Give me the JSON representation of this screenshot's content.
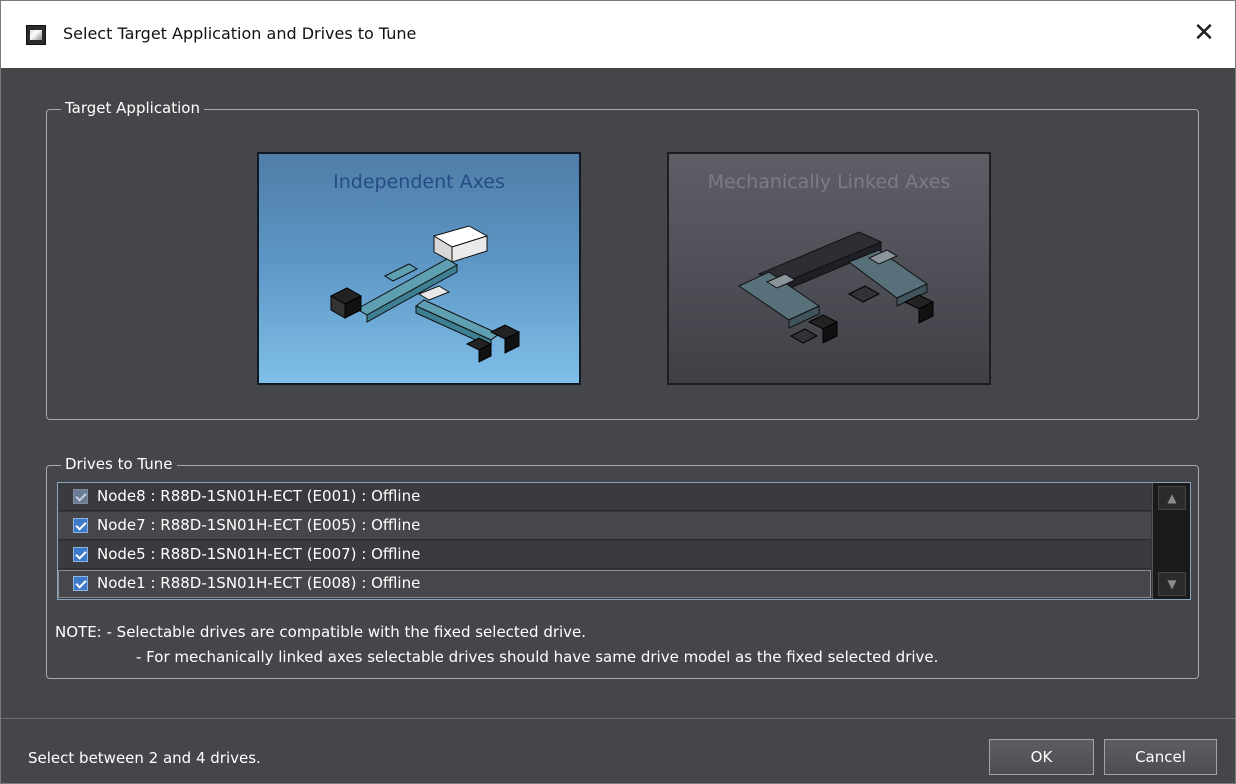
{
  "window": {
    "title": "Select Target Application and Drives to Tune",
    "close_glyph": "✕"
  },
  "target_application": {
    "legend": "Target Application",
    "options": [
      {
        "label": "Independent Axes",
        "selected": true
      },
      {
        "label": "Mechanically Linked Axes",
        "selected": false
      }
    ]
  },
  "drives": {
    "legend": "Drives to Tune",
    "items": [
      {
        "label": "Node8 : R88D-1SN01H-ECT (E001) : Offline",
        "checked": true,
        "enabled": false
      },
      {
        "label": "Node7 : R88D-1SN01H-ECT (E005) : Offline",
        "checked": true,
        "enabled": true
      },
      {
        "label": "Node5 : R88D-1SN01H-ECT (E007) : Offline",
        "checked": true,
        "enabled": true
      },
      {
        "label": "Node1 : R88D-1SN01H-ECT (E008) : Offline",
        "checked": true,
        "enabled": true
      }
    ],
    "note_line1": "NOTE: - Selectable drives are compatible with the fixed selected drive.",
    "note_line2": "- For mechanically linked axes selectable drives should have same drive model as the fixed selected drive."
  },
  "footer": {
    "status": "Select between 2 and 4 drives.",
    "ok_label": "OK",
    "cancel_label": "Cancel"
  },
  "colors": {
    "background": "#45464a",
    "selected_tile": "#5c95c4",
    "checkbox": "#3c79c8"
  }
}
